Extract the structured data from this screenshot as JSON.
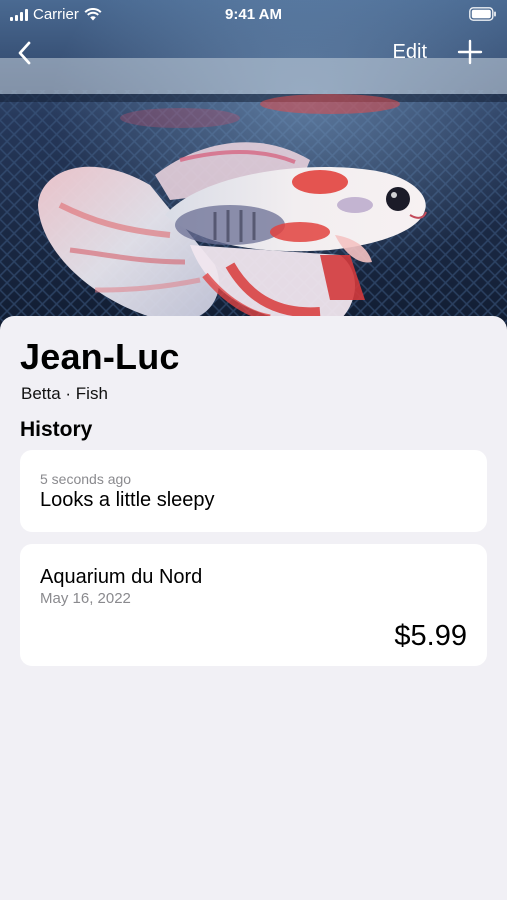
{
  "status_bar": {
    "carrier": "Carrier",
    "time": "9:41 AM"
  },
  "nav": {
    "back_icon": "chevron-left-icon",
    "edit_label": "Edit",
    "add_icon": "plus-icon"
  },
  "pet": {
    "name": "Jean-Luc",
    "subtitle": "Betta · Fish",
    "photo_subject": "betta-fish-photo"
  },
  "history": {
    "title": "History",
    "note": {
      "time": "5 seconds ago",
      "text": "Looks a little sleepy"
    },
    "purchase": {
      "store": "Aquarium du Nord",
      "date": "May 16, 2022",
      "price": "$5.99"
    }
  },
  "colors": {
    "background": "#f1f0f5",
    "card": "#ffffff",
    "secondary_text": "#8a8a8e",
    "fish_red": "#e2423e",
    "aquarium_blue": "#1a2740"
  }
}
